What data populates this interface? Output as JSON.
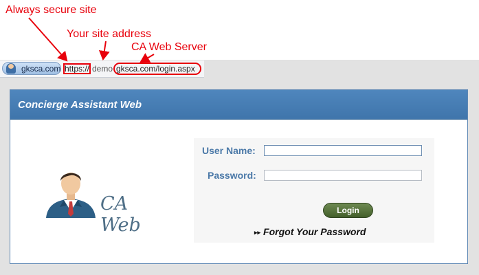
{
  "annotations": {
    "secure": "Always secure site",
    "address": "Your site address",
    "server": "CA Web Server"
  },
  "address_bar": {
    "site_label": "gksca.com",
    "protocol": "https://",
    "subdomain": "demo",
    "domain_path": "gksca.com/login.aspx"
  },
  "panel": {
    "title": "Concierge Assistant Web"
  },
  "logo": {
    "text": "CA Web"
  },
  "login": {
    "username_label": "User Name:",
    "username_value": "",
    "password_label": "Password:",
    "password_value": "",
    "login_button": "Login",
    "forgot_link": "Forgot Your Password"
  },
  "colors": {
    "annotation": "#e8000b",
    "header": "#4a80b8",
    "label": "#4b79a8",
    "button": "#5a7640"
  },
  "icons": {
    "chip": "user-avatar-icon",
    "logo": "businessman-icon",
    "forgot": "double-arrow-icon"
  }
}
